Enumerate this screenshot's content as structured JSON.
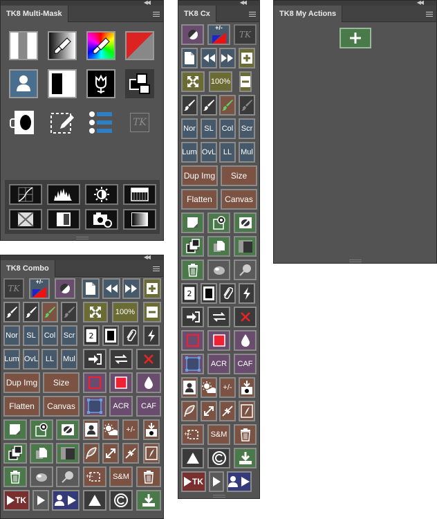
{
  "multi_mask": {
    "title": "TK8 Multi-Mask",
    "tk_logo": "TK"
  },
  "cx": {
    "title": "TK8 Cx",
    "logo": "TK",
    "btn": {
      "pct": "100%",
      "nor": "Nor",
      "sl": "SL",
      "col": "Col",
      "scr": "Scr",
      "lum": "Lum",
      "ovl": "OvL",
      "ll": "LL",
      "mul": "Mul",
      "dup": "Dup Img",
      "size": "Size",
      "flatten": "Flatten",
      "canvas": "Canvas",
      "acr": "ACR",
      "caf": "CAF",
      "pm": "+/-",
      "sm": "S&M",
      "tk": "TK",
      "pmini": "+/-"
    }
  },
  "actions": {
    "title": "TK8 My Actions"
  },
  "combo": {
    "title": "TK8 Combo",
    "logo": "TK",
    "btn": {
      "pct": "100%",
      "nor": "Nor",
      "sl": "SL",
      "col": "Col",
      "scr": "Scr",
      "lum": "Lum",
      "ovl": "OvL",
      "ll": "LL",
      "mul": "Mul",
      "dup": "Dup Img",
      "size": "Size",
      "flatten": "Flatten",
      "canvas": "Canvas",
      "acr": "ACR",
      "caf": "CAF",
      "pm": "+/-",
      "sm": "S&M",
      "tk": "TK",
      "pmini": "+/-"
    }
  }
}
